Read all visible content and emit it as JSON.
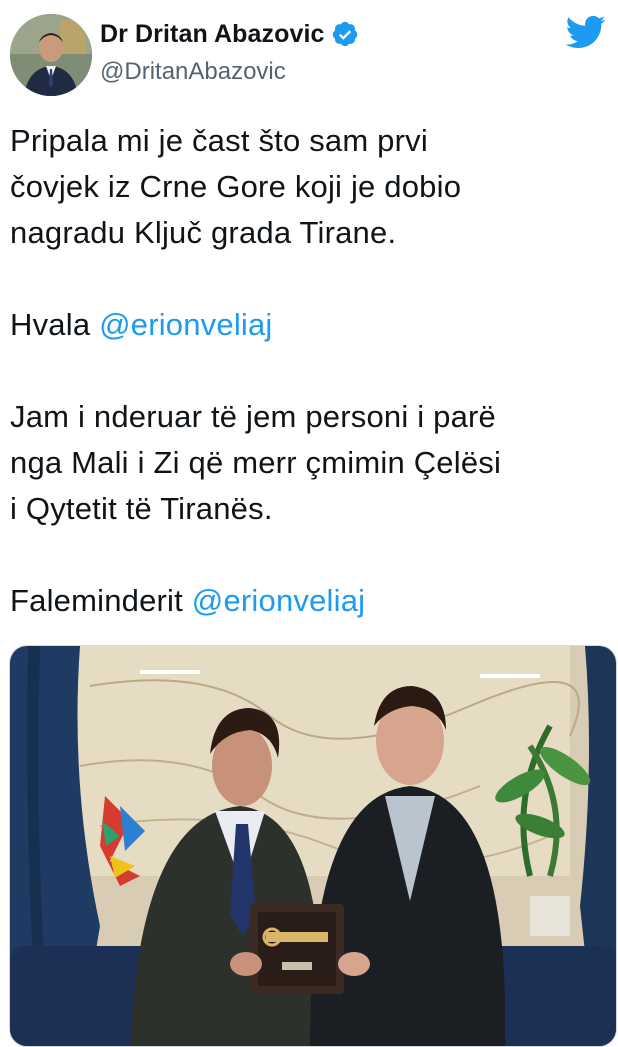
{
  "author": {
    "display_name": "Dr Dritan Abazovic",
    "handle": "@DritanAbazovic",
    "verified": true
  },
  "tweet": {
    "lines_p1": [
      "Pripala mi je čast što sam prvi",
      "čovjek iz Crne Gore koji je dobio",
      "nagradu Ključ grada Tirane."
    ],
    "p2_prefix": "Hvala ",
    "p2_mention": "@erionveliaj",
    "lines_p3": [
      "Jam i nderuar të jem personi i parë",
      "nga Mali i Zi që merr çmimin Çelësi",
      "i Qytetit të Tiranës."
    ],
    "p4_prefix": "Faleminderit ",
    "p4_mention": "@erionveliaj"
  },
  "icons": {
    "brand": "twitter-bird-icon",
    "verified": "verified-badge-icon"
  },
  "colors": {
    "accent": "#1d9bf0",
    "text": "#0f1419",
    "secondary": "#536471"
  }
}
